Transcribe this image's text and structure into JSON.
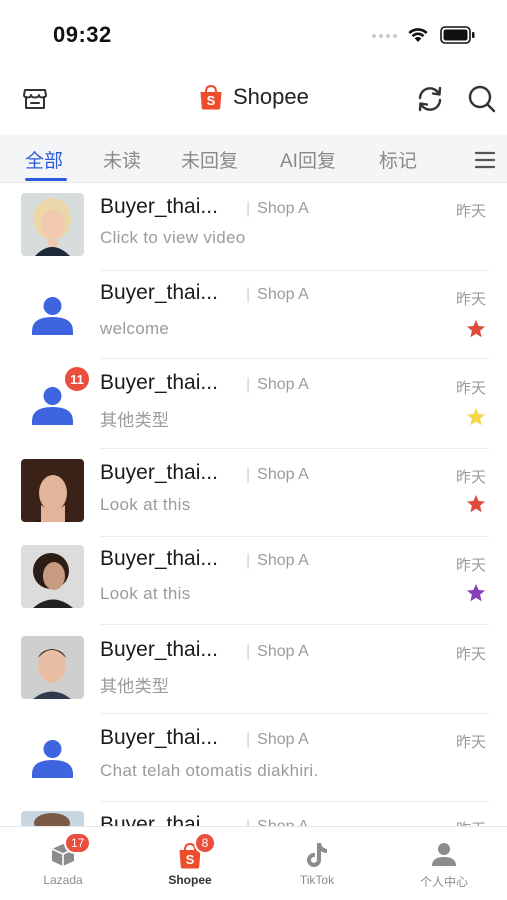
{
  "status_bar": {
    "time": "09:32"
  },
  "header": {
    "title": "Shopee",
    "brand_color": "#ee4d2d"
  },
  "tabs": [
    {
      "label": "全部",
      "active": true
    },
    {
      "label": "未读",
      "active": false
    },
    {
      "label": "未回复",
      "active": false
    },
    {
      "label": "AI回复",
      "active": false
    },
    {
      "label": "标记",
      "active": false
    }
  ],
  "conversations": [
    {
      "name": "Buyer_thai...",
      "shop": "Shop A",
      "preview": "Click to view video",
      "date": "昨天",
      "avatar": "photo-blonde-woman",
      "star": null,
      "unread": null
    },
    {
      "name": "Buyer_thai...",
      "shop": "Shop A",
      "preview": "welcome",
      "date": "昨天",
      "avatar": "default-user",
      "star": "#e04a3b",
      "unread": null
    },
    {
      "name": "Buyer_thai...",
      "shop": "Shop A",
      "preview": "其他类型",
      "date": "昨天",
      "avatar": "default-user",
      "star": "#f5d84a",
      "unread": "11"
    },
    {
      "name": "Buyer_thai...",
      "shop": "Shop A",
      "preview": "Look at this",
      "date": "昨天",
      "avatar": "photo-brunette-woman",
      "star": "#e04a3b",
      "unread": null
    },
    {
      "name": "Buyer_thai...",
      "shop": "Shop A",
      "preview": "Look at this",
      "date": "昨天",
      "avatar": "photo-curly-woman",
      "star": "#8a3fb8",
      "unread": null
    },
    {
      "name": "Buyer_thai...",
      "shop": "Shop A",
      "preview": "其他类型",
      "date": "昨天",
      "avatar": "photo-man",
      "star": null,
      "unread": null
    },
    {
      "name": "Buyer_thai...",
      "shop": "Shop A",
      "preview": "Chat telah otomatis diakhiri.",
      "date": "昨天",
      "avatar": "default-user",
      "star": null,
      "unread": null
    },
    {
      "name": "Buyer_thai...",
      "shop": "Shop A",
      "preview": "",
      "date": "昨天",
      "avatar": "photo-partial",
      "star": null,
      "unread": null
    }
  ],
  "bottom_nav": [
    {
      "label": "Lazada",
      "badge": "17",
      "icon": "lazada-box-icon",
      "active": false
    },
    {
      "label": "Shopee",
      "badge": "8",
      "icon": "shopee-bag-icon",
      "active": true
    },
    {
      "label": "TikTok",
      "badge": null,
      "icon": "tiktok-note-icon",
      "active": false
    },
    {
      "label": "个人中心",
      "badge": null,
      "icon": "person-icon",
      "active": false
    }
  ],
  "colors": {
    "accent": "#2d5bdc",
    "badge": "#ea4e3d",
    "default_avatar": "#3e64e0"
  }
}
